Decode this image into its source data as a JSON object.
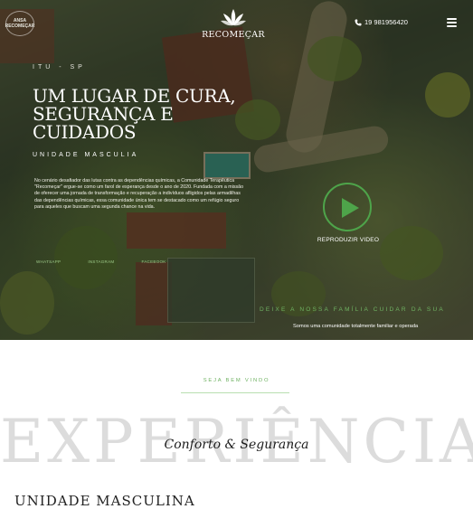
{
  "header": {
    "left_logo_text": "ANSA RECOMEÇAR",
    "brand_name": "RECOMEÇAR",
    "phone": "19 981956420"
  },
  "hero": {
    "location": "ITU - SP",
    "headline": "UM LUGAR DE CURA, SEGURANÇA E CUIDADOS",
    "subline": "UNIDADE MASCULIA",
    "description": "No cenário desafiador das lutas contra as dependências químicas, a Comunidade Terapêutica \"Recomeçar\" ergue-se como um farol de esperança desde o ano de 2020. Fundada com a missão de oferecer uma jornada de transformação e recuperação a indivíduos afligidos pelas armadilhas das dependências químicas, essa comunidade única tem se destacado como um refúgio seguro para aqueles que buscam uma segunda chance na vida.",
    "stats": [
      "WHATSAPP",
      "INSTAGRAM",
      "FACEBOOK"
    ],
    "video_label": "REPRODUZIR VIDEO",
    "tagline": "DEIXE A NOSSA FAMÍLIA CUIDAR DA SUA",
    "tagline_sub": "Somos uma comunidade totalmente familiar e operada"
  },
  "section": {
    "welcome": "SEJA BEM VINDO",
    "background_word": "EXPERIÊNCIA",
    "title": "Conforto & Segurança",
    "next_heading": "UNIDADE MASCULINA"
  },
  "colors": {
    "accent_green": "#6fb262",
    "play_green": "#4ea44a"
  }
}
